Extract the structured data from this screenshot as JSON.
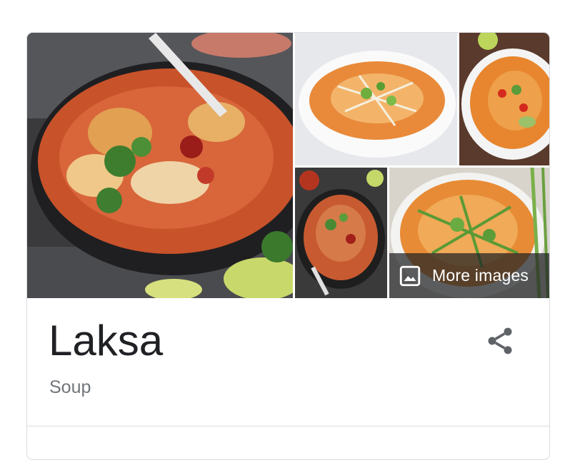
{
  "knowledge_panel": {
    "title": "Laksa",
    "subtitle": "Soup",
    "more_images_label": "More images",
    "share_icon": "share-icon",
    "image_icon": "image-icon"
  },
  "colors": {
    "title": "#202124",
    "subtitle": "#70757a",
    "border": "#dadce0",
    "overlay": "#202124",
    "share_icon": "#5f6368"
  }
}
